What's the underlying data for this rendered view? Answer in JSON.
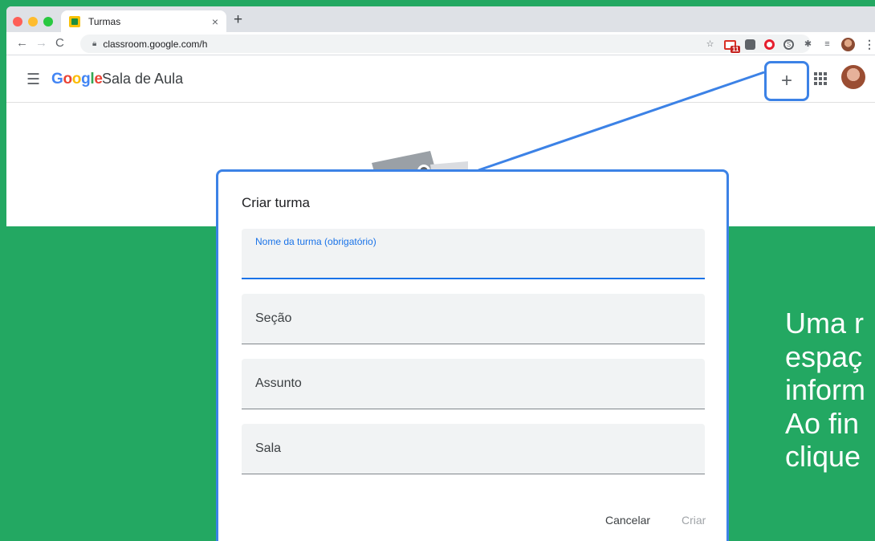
{
  "browser": {
    "tab_title": "Turmas",
    "tab_close": "×",
    "new_tab": "+",
    "url": "classroom.google.com/h",
    "gmail_badge": "11"
  },
  "app": {
    "logo_letters": [
      "G",
      "o",
      "o",
      "g",
      "l",
      "e"
    ],
    "name": "Sala de Aula",
    "plus_label": "+"
  },
  "dialog": {
    "title": "Criar turma",
    "fields": [
      {
        "label": "Nome da turma (obrigatório)",
        "active": true
      },
      {
        "label": "Seção"
      },
      {
        "label": "Assunto"
      },
      {
        "label": "Sala"
      }
    ],
    "cancel_label": "Cancelar",
    "create_label": "Criar"
  },
  "side_text": {
    "lines": [
      "Uma r",
      "espaç",
      "inform",
      "Ao fin",
      "clique"
    ]
  },
  "colors": {
    "background": "#23a862",
    "highlight": "#3c82e6",
    "field_active": "#1a73e8"
  }
}
